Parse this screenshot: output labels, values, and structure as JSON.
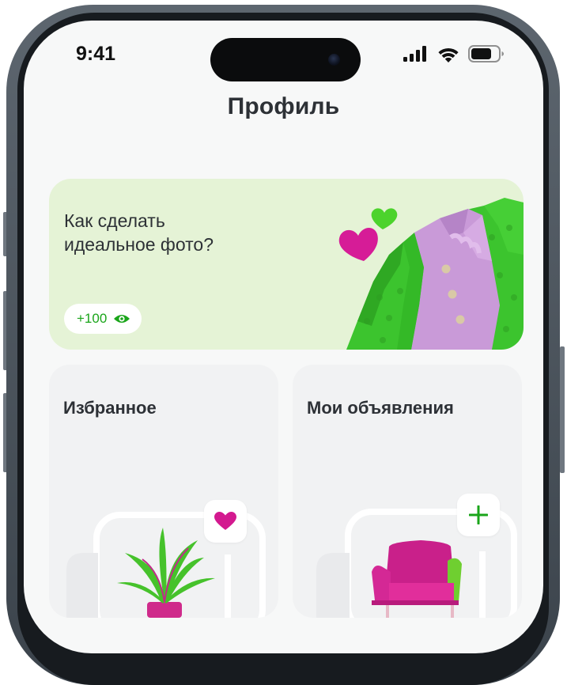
{
  "status_bar": {
    "time": "9:41",
    "icons": [
      "signal-icon",
      "wifi-icon",
      "battery-icon"
    ]
  },
  "header": {
    "title": "Профиль"
  },
  "promo": {
    "text": "Как сделать идеальное фото?",
    "badge": "+100",
    "badge_icon": "eye-icon",
    "accent_color": "#1aa51a",
    "background_color": "#e5f3d6"
  },
  "cards": [
    {
      "title": "Избранное",
      "action_icon": "heart-icon",
      "action_color": "#d3198f"
    },
    {
      "title": "Мои объявления",
      "action_icon": "plus-icon",
      "action_color": "#1aa51a"
    }
  ]
}
